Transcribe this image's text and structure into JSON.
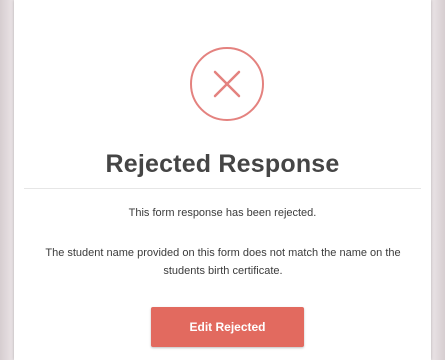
{
  "dialog": {
    "title": "Rejected Response",
    "message": "This form response has been rejected.",
    "reason": "The student name provided on this form does not match the name on the students birth certificate.",
    "edit_button_label": "Edit Rejected",
    "status_icon": "close-icon"
  },
  "colors": {
    "accent": "#e26a5f",
    "icon_ring": "#e4827f",
    "title_text": "#454545",
    "body_text": "#3b3b3b"
  }
}
